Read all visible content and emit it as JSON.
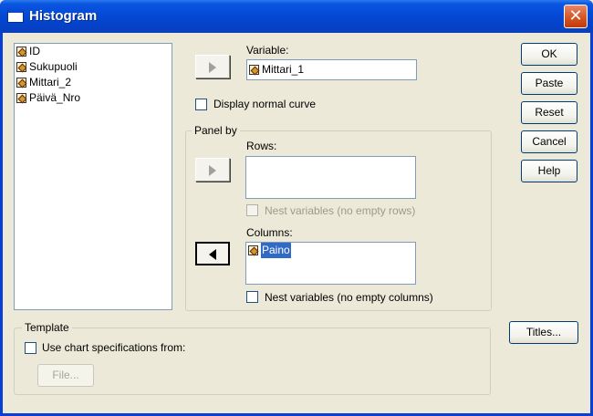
{
  "window": {
    "title": "Histogram",
    "close_label": "✕"
  },
  "source_list": {
    "items": [
      {
        "label": "ID",
        "icon": "scale-variable-icon"
      },
      {
        "label": "Sukupuoli",
        "icon": "scale-variable-icon"
      },
      {
        "label": "Mittari_2",
        "icon": "scale-variable-icon"
      },
      {
        "label": "Päivä_Nro",
        "icon": "scale-variable-icon"
      }
    ]
  },
  "variable": {
    "label": "Variable:",
    "value": "Mittari_1"
  },
  "normal_curve": {
    "label": "Display normal curve",
    "checked": false
  },
  "panel_by": {
    "title": "Panel by",
    "rows_label": "Rows:",
    "nest_rows_label": "Nest variables (no empty rows)",
    "columns_label": "Columns:",
    "columns_value": "Paino",
    "nest_columns_label": "Nest variables (no empty columns)"
  },
  "template": {
    "title": "Template",
    "use_spec_label": "Use chart specifications from:",
    "file_label": "File..."
  },
  "buttons": {
    "ok": "OK",
    "paste": "Paste",
    "reset": "Reset",
    "cancel": "Cancel",
    "help": "Help",
    "titles": "Titles..."
  },
  "colors": {
    "titlebar": "#0549d6",
    "selection": "#316ac5",
    "close": "#d5521e"
  }
}
